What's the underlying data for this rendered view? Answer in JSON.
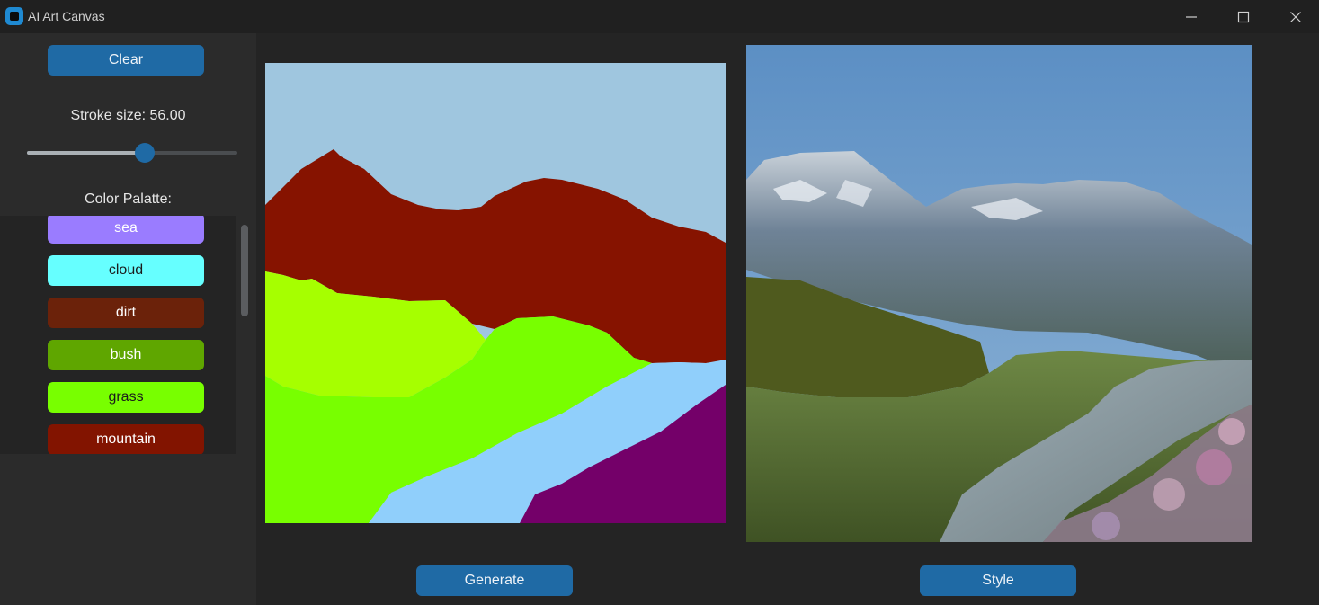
{
  "window": {
    "title": "AI Art Canvas",
    "controls": [
      "minimize-icon",
      "maximize-icon",
      "close-icon"
    ]
  },
  "sidebar": {
    "clear_label": "Clear",
    "stroke_label": "Stroke size: 56.00",
    "stroke_fraction": 0.56,
    "palette_label": "Color Palatte:",
    "palette": [
      {
        "label": "sea",
        "color": "#9a7cff",
        "text_color": "#ffffff"
      },
      {
        "label": "cloud",
        "color": "#66ffff",
        "text_color": "#1b1b1b"
      },
      {
        "label": "dirt",
        "color": "#6b220a",
        "text_color": "#ffffff"
      },
      {
        "label": "bush",
        "color": "#5fa600",
        "text_color": "#ffffff"
      },
      {
        "label": "grass",
        "color": "#78ff00",
        "text_color": "#1b1b1b"
      },
      {
        "label": "mountain",
        "color": "#821400",
        "text_color": "#ffffff"
      }
    ]
  },
  "main": {
    "generate_label": "Generate",
    "style_label": "Style"
  },
  "colors": {
    "accent": "#1f6aa5",
    "sky": "#9fc6df",
    "mountain": "#861300",
    "bush": "#a6ff00",
    "grass": "#78ff00",
    "river": "#90cffb",
    "flower": "#740069"
  }
}
